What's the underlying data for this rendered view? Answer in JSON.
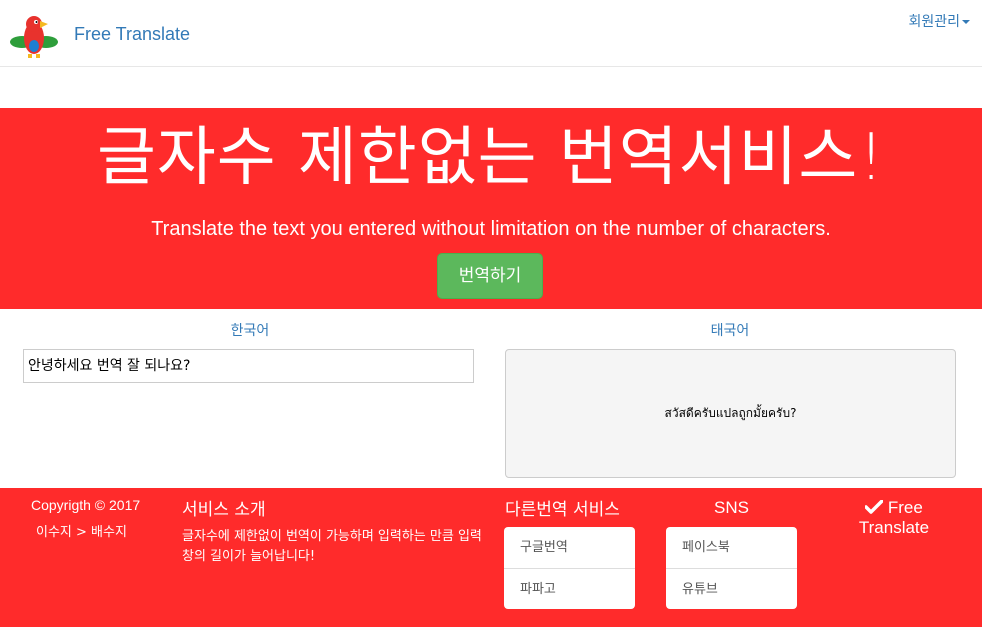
{
  "navbar": {
    "brand": "Free Translate",
    "member_menu": "회원관리",
    "logo_icon": "parrot-logo-icon"
  },
  "hero": {
    "title": "글자수 제한없는 번역서비스!",
    "subtitle": "Translate the text you entered without limitation on the number of characters.",
    "translate_button": "번역하기"
  },
  "translator": {
    "source_language": "한국어",
    "target_language": "태국어",
    "source_text": "안녕하세요 번역 잘 되나요?",
    "target_text": "สวัสดีครับแปลถูกมั้ยครับ?"
  },
  "footer": {
    "copyright": "Copyrigth © 2017",
    "authors": "이수지 > 배수지",
    "service_title": "서비스 소개",
    "service_description": "글자수에 제한없이 번역이 가능하며 입력하는 만큼 입력창의 길이가 늘어납니다!",
    "other_services_title": "다른번역 서비스",
    "other_services": [
      "구글번역",
      "파파고"
    ],
    "sns_title": "SNS",
    "sns": [
      "페이스북",
      "유튜브"
    ],
    "brand_line1": "Free",
    "brand_line2": "Translate"
  },
  "colors": {
    "accent_red": "#ff2b2b",
    "brand_blue": "#337ab7",
    "button_green": "#5cb85c"
  }
}
